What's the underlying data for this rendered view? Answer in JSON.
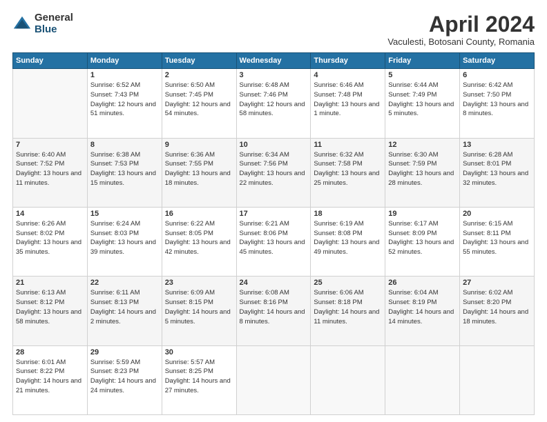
{
  "logo": {
    "general": "General",
    "blue": "Blue"
  },
  "title": "April 2024",
  "subtitle": "Vaculesti, Botosani County, Romania",
  "days": [
    "Sunday",
    "Monday",
    "Tuesday",
    "Wednesday",
    "Thursday",
    "Friday",
    "Saturday"
  ],
  "weeks": [
    [
      {
        "day": "",
        "empty": true
      },
      {
        "day": "1",
        "sunrise": "Sunrise: 6:52 AM",
        "sunset": "Sunset: 7:43 PM",
        "daylight": "Daylight: 12 hours and 51 minutes."
      },
      {
        "day": "2",
        "sunrise": "Sunrise: 6:50 AM",
        "sunset": "Sunset: 7:45 PM",
        "daylight": "Daylight: 12 hours and 54 minutes."
      },
      {
        "day": "3",
        "sunrise": "Sunrise: 6:48 AM",
        "sunset": "Sunset: 7:46 PM",
        "daylight": "Daylight: 12 hours and 58 minutes."
      },
      {
        "day": "4",
        "sunrise": "Sunrise: 6:46 AM",
        "sunset": "Sunset: 7:48 PM",
        "daylight": "Daylight: 13 hours and 1 minute."
      },
      {
        "day": "5",
        "sunrise": "Sunrise: 6:44 AM",
        "sunset": "Sunset: 7:49 PM",
        "daylight": "Daylight: 13 hours and 5 minutes."
      },
      {
        "day": "6",
        "sunrise": "Sunrise: 6:42 AM",
        "sunset": "Sunset: 7:50 PM",
        "daylight": "Daylight: 13 hours and 8 minutes."
      }
    ],
    [
      {
        "day": "7",
        "sunrise": "Sunrise: 6:40 AM",
        "sunset": "Sunset: 7:52 PM",
        "daylight": "Daylight: 13 hours and 11 minutes."
      },
      {
        "day": "8",
        "sunrise": "Sunrise: 6:38 AM",
        "sunset": "Sunset: 7:53 PM",
        "daylight": "Daylight: 13 hours and 15 minutes."
      },
      {
        "day": "9",
        "sunrise": "Sunrise: 6:36 AM",
        "sunset": "Sunset: 7:55 PM",
        "daylight": "Daylight: 13 hours and 18 minutes."
      },
      {
        "day": "10",
        "sunrise": "Sunrise: 6:34 AM",
        "sunset": "Sunset: 7:56 PM",
        "daylight": "Daylight: 13 hours and 22 minutes."
      },
      {
        "day": "11",
        "sunrise": "Sunrise: 6:32 AM",
        "sunset": "Sunset: 7:58 PM",
        "daylight": "Daylight: 13 hours and 25 minutes."
      },
      {
        "day": "12",
        "sunrise": "Sunrise: 6:30 AM",
        "sunset": "Sunset: 7:59 PM",
        "daylight": "Daylight: 13 hours and 28 minutes."
      },
      {
        "day": "13",
        "sunrise": "Sunrise: 6:28 AM",
        "sunset": "Sunset: 8:01 PM",
        "daylight": "Daylight: 13 hours and 32 minutes."
      }
    ],
    [
      {
        "day": "14",
        "sunrise": "Sunrise: 6:26 AM",
        "sunset": "Sunset: 8:02 PM",
        "daylight": "Daylight: 13 hours and 35 minutes."
      },
      {
        "day": "15",
        "sunrise": "Sunrise: 6:24 AM",
        "sunset": "Sunset: 8:03 PM",
        "daylight": "Daylight: 13 hours and 39 minutes."
      },
      {
        "day": "16",
        "sunrise": "Sunrise: 6:22 AM",
        "sunset": "Sunset: 8:05 PM",
        "daylight": "Daylight: 13 hours and 42 minutes."
      },
      {
        "day": "17",
        "sunrise": "Sunrise: 6:21 AM",
        "sunset": "Sunset: 8:06 PM",
        "daylight": "Daylight: 13 hours and 45 minutes."
      },
      {
        "day": "18",
        "sunrise": "Sunrise: 6:19 AM",
        "sunset": "Sunset: 8:08 PM",
        "daylight": "Daylight: 13 hours and 49 minutes."
      },
      {
        "day": "19",
        "sunrise": "Sunrise: 6:17 AM",
        "sunset": "Sunset: 8:09 PM",
        "daylight": "Daylight: 13 hours and 52 minutes."
      },
      {
        "day": "20",
        "sunrise": "Sunrise: 6:15 AM",
        "sunset": "Sunset: 8:11 PM",
        "daylight": "Daylight: 13 hours and 55 minutes."
      }
    ],
    [
      {
        "day": "21",
        "sunrise": "Sunrise: 6:13 AM",
        "sunset": "Sunset: 8:12 PM",
        "daylight": "Daylight: 13 hours and 58 minutes."
      },
      {
        "day": "22",
        "sunrise": "Sunrise: 6:11 AM",
        "sunset": "Sunset: 8:13 PM",
        "daylight": "Daylight: 14 hours and 2 minutes."
      },
      {
        "day": "23",
        "sunrise": "Sunrise: 6:09 AM",
        "sunset": "Sunset: 8:15 PM",
        "daylight": "Daylight: 14 hours and 5 minutes."
      },
      {
        "day": "24",
        "sunrise": "Sunrise: 6:08 AM",
        "sunset": "Sunset: 8:16 PM",
        "daylight": "Daylight: 14 hours and 8 minutes."
      },
      {
        "day": "25",
        "sunrise": "Sunrise: 6:06 AM",
        "sunset": "Sunset: 8:18 PM",
        "daylight": "Daylight: 14 hours and 11 minutes."
      },
      {
        "day": "26",
        "sunrise": "Sunrise: 6:04 AM",
        "sunset": "Sunset: 8:19 PM",
        "daylight": "Daylight: 14 hours and 14 minutes."
      },
      {
        "day": "27",
        "sunrise": "Sunrise: 6:02 AM",
        "sunset": "Sunset: 8:20 PM",
        "daylight": "Daylight: 14 hours and 18 minutes."
      }
    ],
    [
      {
        "day": "28",
        "sunrise": "Sunrise: 6:01 AM",
        "sunset": "Sunset: 8:22 PM",
        "daylight": "Daylight: 14 hours and 21 minutes."
      },
      {
        "day": "29",
        "sunrise": "Sunrise: 5:59 AM",
        "sunset": "Sunset: 8:23 PM",
        "daylight": "Daylight: 14 hours and 24 minutes."
      },
      {
        "day": "30",
        "sunrise": "Sunrise: 5:57 AM",
        "sunset": "Sunset: 8:25 PM",
        "daylight": "Daylight: 14 hours and 27 minutes."
      },
      {
        "day": "",
        "empty": true
      },
      {
        "day": "",
        "empty": true
      },
      {
        "day": "",
        "empty": true
      },
      {
        "day": "",
        "empty": true
      }
    ]
  ]
}
